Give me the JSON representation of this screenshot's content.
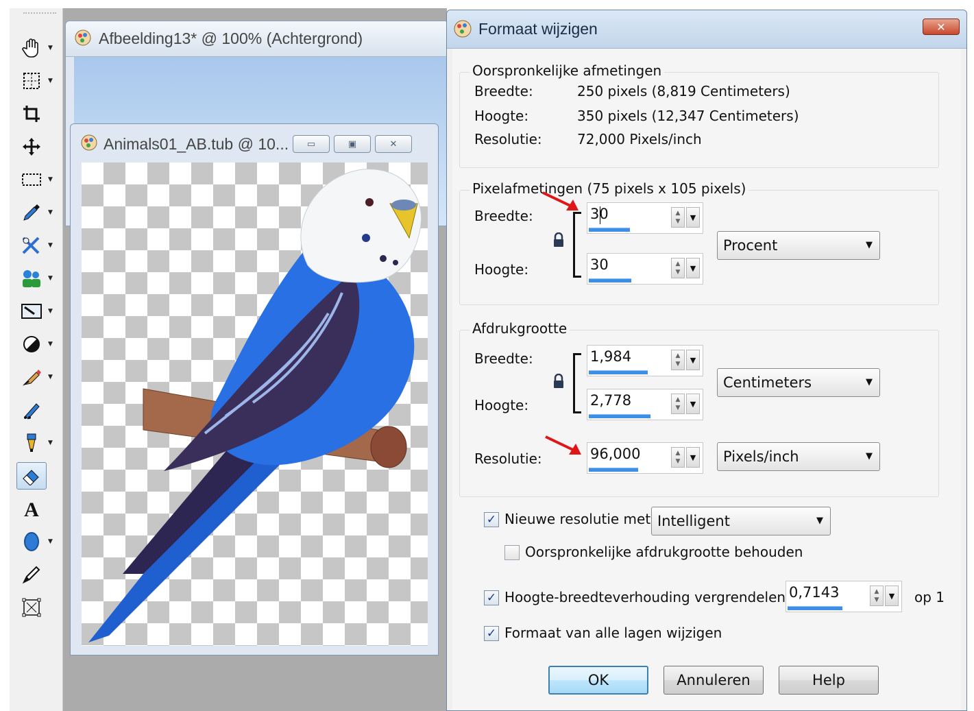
{
  "back_window": {
    "title": "Afbeelding13* @ 100% (Achtergrond)"
  },
  "front_window": {
    "title": "Animals01_AB.tub @ 10..."
  },
  "toolbar": {
    "tools": [
      {
        "icon": "pan-hand-icon"
      },
      {
        "icon": "zoom-grid-icon"
      },
      {
        "icon": "crop-icon"
      },
      {
        "icon": "move-icon"
      },
      {
        "icon": "selection-icon"
      },
      {
        "icon": "dropper-icon"
      },
      {
        "icon": "clone-icon"
      },
      {
        "icon": "makeover-icon"
      },
      {
        "icon": "scratch-remover-icon"
      },
      {
        "icon": "dodge-icon"
      },
      {
        "icon": "paint-brush-icon"
      },
      {
        "icon": "retouch-icon"
      },
      {
        "icon": "fill-icon"
      },
      {
        "icon": "eraser-icon"
      },
      {
        "icon": "text-icon"
      },
      {
        "icon": "shape-icon"
      },
      {
        "icon": "pen-icon"
      },
      {
        "icon": "warp-icon"
      }
    ]
  },
  "dialog": {
    "title": "Formaat wijzigen",
    "original": {
      "legend": "Oorspronkelijke afmetingen",
      "width_label": "Breedte:",
      "width_value": "250 pixels (8,819 Centimeters)",
      "height_label": "Hoogte:",
      "height_value": "350 pixels (12,347 Centimeters)",
      "resolution_label": "Resolutie:",
      "resolution_value": "72,000 Pixels/inch"
    },
    "pixel": {
      "legend": "Pixelafmetingen (75 pixels x 105 pixels)",
      "width_label": "Breedte:",
      "width_value": "30",
      "height_label": "Hoogte:",
      "height_value": "30",
      "unit": "Procent"
    },
    "print": {
      "legend": "Afdrukgrootte",
      "width_label": "Breedte:",
      "width_value": "1,984",
      "height_label": "Hoogte:",
      "height_value": "2,778",
      "unit": "Centimeters",
      "resolution_label": "Resolutie:",
      "resolution_value": "96,000",
      "resolution_unit": "Pixels/inch"
    },
    "resample": {
      "label": "Nieuwe resolutie met:",
      "checked": true,
      "method": "Intelligent"
    },
    "keep_print": {
      "label": "Oorspronkelijke afdrukgrootte behouden",
      "checked": false
    },
    "aspect": {
      "label": "Hoogte-breedteverhouding vergrendelen:",
      "checked": true,
      "value": "0,7143",
      "suffix": "op 1"
    },
    "all_layers": {
      "label": "Formaat van alle lagen wijzigen",
      "checked": true
    },
    "buttons": {
      "ok": "OK",
      "cancel": "Annuleren",
      "help": "Help"
    }
  },
  "colors": {
    "accent": "#3c8ee6",
    "arrow": "#e01515",
    "titlebar": "#c2d5ea",
    "close": "#c9482d"
  }
}
